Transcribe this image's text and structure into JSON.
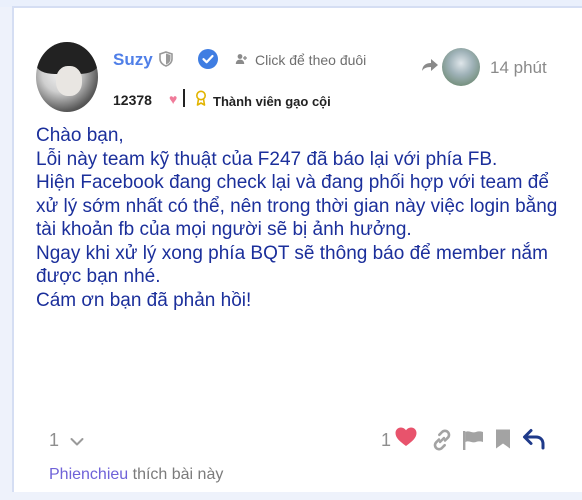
{
  "post": {
    "author": {
      "username": "Suzy",
      "follow_label": "Click để theo đuôi",
      "score": "12378",
      "title": "Thành viên gạo cội"
    },
    "time": "14 phút",
    "content": [
      "Chào bạn,",
      "Lỗi này team kỹ thuật của F247 đã báo lại với phía FB.",
      "Hiện Facebook đang check lại và đang phối hợp với team để xử lý sớm nhất có thể, nên trong thời gian này việc login bằng tài khoản fb của mọi người sẽ bị ảnh hưởng.",
      "Ngay khi xử lý xong phía BQT sẽ thông báo để member nắm được bạn nhé.",
      "Cám ơn bạn đã phản hồi!"
    ],
    "reply_count": "1",
    "like_count": "1",
    "likers": {
      "name": "Phienchieu",
      "suffix": "thích bài này"
    }
  },
  "colors": {
    "accent": "#4f7fe8",
    "content_text": "#1b2f9b",
    "heart": "#e8536c",
    "reply": "#1f3a8a"
  },
  "icons": [
    "shield-icon",
    "verified-check-icon",
    "person-add-icon",
    "reply-arrow-icon",
    "heart-icon",
    "medal-icon",
    "chevron-down-icon",
    "link-icon",
    "flag-icon",
    "bookmark-icon",
    "reply-icon"
  ]
}
